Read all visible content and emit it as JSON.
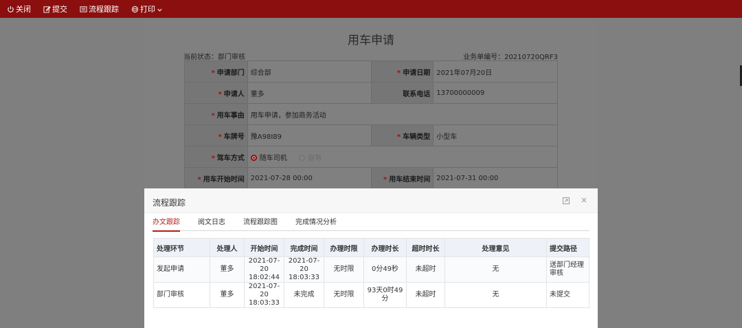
{
  "toolbar": {
    "close": "关闭",
    "submit": "提交",
    "trace": "流程跟踪",
    "print": "打印"
  },
  "form": {
    "title": "用车申请",
    "status_label": "当前状态：部门审核",
    "doc_label": "业务单编号：20210720QRF3",
    "dept_label": "申请部门",
    "dept_value": "综合部",
    "date_label": "申请日期",
    "date_value": "2021年07月20日",
    "applicant_label": "申请人",
    "applicant_value": "董多",
    "phone_label": "联系电话",
    "phone_value": "13700000009",
    "reason_label": "用车事由",
    "reason_value": "用车申请，参加商务活动",
    "plate_label": "车牌号",
    "plate_value": "豫A98I89",
    "type_label": "车辆类型",
    "type_value": "小型车",
    "drive_label": "驾车方式",
    "drive_opt1": "随车司机",
    "drive_opt2": "自驾",
    "start_label": "用车开始时间",
    "start_value": "2021-07-28 00:00",
    "end_label": "用车结束时间",
    "end_value": "2021-07-31 00:00"
  },
  "dialog": {
    "title": "流程跟踪",
    "tabs": [
      "办文跟踪",
      "阅文日志",
      "流程跟踪图",
      "完成情况分析"
    ],
    "columns": [
      "处理环节",
      "处理人",
      "开始时间",
      "完成时间",
      "办理时限",
      "办理时长",
      "超时时长",
      "处理意见",
      "提交路径"
    ],
    "rows": [
      [
        "发起申请",
        "董多",
        "2021-07-20 18:02:44",
        "2021-07-20 18:03:33",
        "无时限",
        "0分49秒",
        "未超时",
        "无",
        "送部门经理审核"
      ],
      [
        "部门审核",
        "董多",
        "2021-07-20 18:03:33",
        "未完成",
        "无时限",
        "93天0时49分",
        "未超时",
        "无",
        "未提交"
      ]
    ]
  }
}
